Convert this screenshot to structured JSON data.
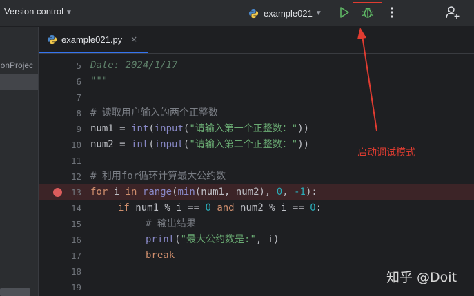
{
  "toolbar": {
    "version_control_label": "Version control",
    "run_config_label": "example021",
    "run_icon": "play-icon",
    "debug_icon": "bug-icon",
    "more_icon": "more-vertical-icon",
    "add_user_icon": "add-user-icon"
  },
  "sidebar": {
    "project_label": "honProjec"
  },
  "tabs": [
    {
      "label": "example021.py",
      "close": "×",
      "icon": "python-file-icon"
    }
  ],
  "editor": {
    "lines": [
      {
        "n": "5",
        "breakpoint": false
      },
      {
        "n": "6",
        "breakpoint": false
      },
      {
        "n": "7",
        "breakpoint": false
      },
      {
        "n": "8",
        "breakpoint": false
      },
      {
        "n": "9",
        "breakpoint": false
      },
      {
        "n": "10",
        "breakpoint": false
      },
      {
        "n": "11",
        "breakpoint": false
      },
      {
        "n": "12",
        "breakpoint": false
      },
      {
        "n": "13",
        "breakpoint": true
      },
      {
        "n": "14",
        "breakpoint": false
      },
      {
        "n": "15",
        "breakpoint": false
      },
      {
        "n": "16",
        "breakpoint": false
      },
      {
        "n": "17",
        "breakpoint": false
      },
      {
        "n": "18",
        "breakpoint": false
      },
      {
        "n": "19",
        "breakpoint": false
      }
    ],
    "code": {
      "l5": "Date: 2024/1/17",
      "l6": "\"\"\"",
      "l8": "# 读取用户输入的两个正整数",
      "l9_var": "num1 = ",
      "l9_int": "int",
      "l9_p1": "(",
      "l9_input": "input",
      "l9_p2": "(",
      "l9_str": "\"请输入第一个正整数：\"",
      "l9_p3": "))",
      "l10_var": "num2 = ",
      "l10_int": "int",
      "l10_p1": "(",
      "l10_input": "input",
      "l10_p2": "(",
      "l10_str": "\"请输入第二个正整数：\"",
      "l10_p3": "))",
      "l12": "# 利用for循环计算最大公约数",
      "l13_for": "for",
      "l13_i": " i ",
      "l13_in": "in",
      "l13_sp": " ",
      "l13_range": "range",
      "l13_p1": "(",
      "l13_min": "min",
      "l13_args": "(num1, num2), ",
      "l13_zero": "0",
      "l13_comma": ", ",
      "l13_neg": "-1",
      "l13_end": "):",
      "l14_if": "if",
      "l14_a": " num1 % i == ",
      "l14_zero1": "0",
      "l14_sp": " ",
      "l14_and": "and",
      "l14_b": " num2 % i == ",
      "l14_zero2": "0",
      "l14_colon": ":",
      "l15": "# 输出结果",
      "l16_print": "print",
      "l16_p1": "(",
      "l16_str": "\"最大公约数是:\"",
      "l16_rest": ", i)",
      "l17": "break"
    }
  },
  "annotation": {
    "text": "启动调试模式",
    "color": "#e03c31"
  },
  "watermark": {
    "text": "知乎 @Doit"
  },
  "colors": {
    "accent": "#3574f0",
    "breakpoint": "#db5c5c",
    "run_green": "#5fb865",
    "string": "#6aab73",
    "keyword": "#cf8e6d",
    "builtin": "#8888c6",
    "number": "#2aacb8"
  }
}
